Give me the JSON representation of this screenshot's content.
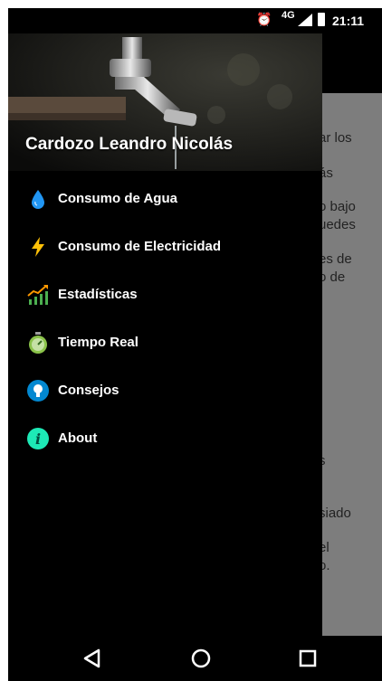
{
  "status_bar": {
    "network": "4G",
    "time": "21:11"
  },
  "drawer": {
    "user_name": "Cardozo Leandro Nicolás",
    "items": [
      {
        "label": "Consumo de Agua",
        "icon": "water-drop-icon"
      },
      {
        "label": "Consumo de Electricidad",
        "icon": "lightning-icon"
      },
      {
        "label": "Estadísticas",
        "icon": "stats-chart-icon"
      },
      {
        "label": "Tiempo Real",
        "icon": "stopwatch-icon"
      },
      {
        "label": "Consejos",
        "icon": "lightbulb-icon"
      },
      {
        "label": "About",
        "icon": "info-icon"
      }
    ]
  },
  "background_fragments": [
    "ar los",
    "ás",
    "o bajo",
    "uedes",
    "es de",
    "o de",
    "s",
    "siado",
    "el",
    "o."
  ],
  "colors": {
    "drawer_bg": "#000000",
    "scrim": "#7d7d7d",
    "water": "#2196f3",
    "lightning": "#ffc107",
    "info": "#1de9b6"
  }
}
